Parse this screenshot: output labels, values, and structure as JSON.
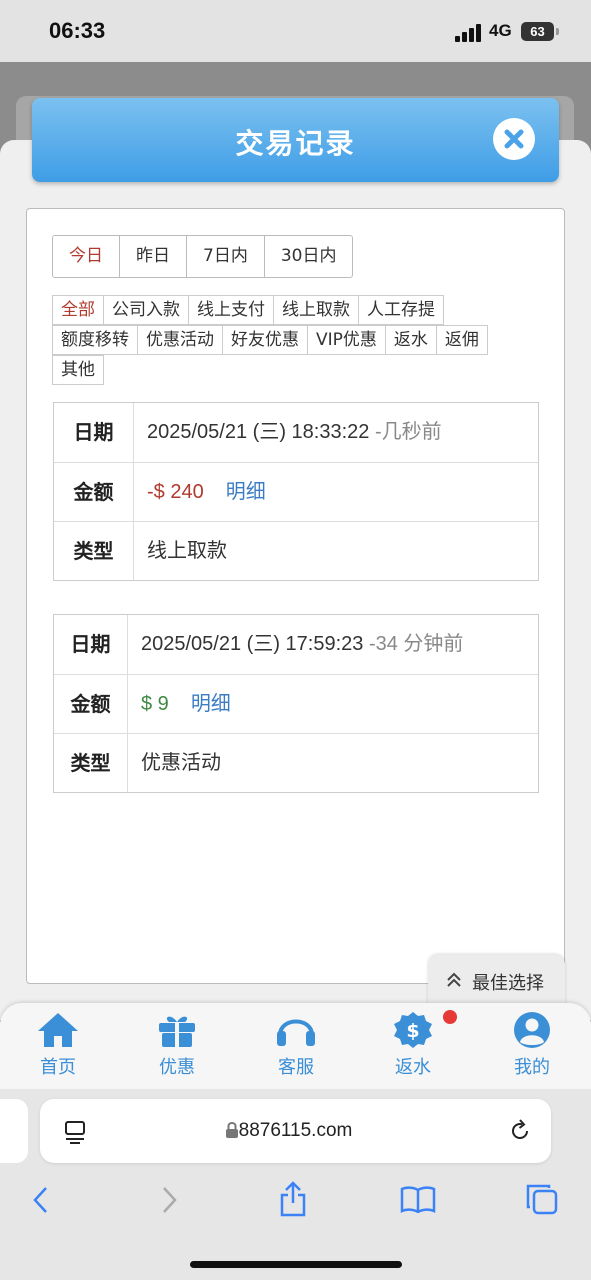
{
  "status_bar": {
    "time": "06:33",
    "network": "4G",
    "battery": "63"
  },
  "modal": {
    "title": "交易记录"
  },
  "date_tabs": [
    {
      "label": "今日",
      "active": true
    },
    {
      "label": "昨日",
      "active": false
    },
    {
      "label": "7日内",
      "active": false
    },
    {
      "label": "30日内",
      "active": false
    }
  ],
  "type_filters": [
    [
      "全部",
      "公司入款",
      "线上支付",
      "线上取款",
      "人工存提"
    ],
    [
      "额度移转",
      "优惠活动",
      "好友优惠",
      "VIP优惠",
      "返水",
      "返佣"
    ],
    [
      "其他"
    ]
  ],
  "active_type": "全部",
  "records": [
    {
      "date_label": "日期",
      "date": "2025/05/21 (三) 18:33:22",
      "ago": "-几秒前",
      "amount_label": "金额",
      "amount": "-$ 240",
      "amount_sign": "negative",
      "detail": "明细",
      "type_label": "类型",
      "type": "线上取款"
    },
    {
      "date_label": "日期",
      "date": "2025/05/21 (三) 17:59:23",
      "ago": "-34 分钟前",
      "amount_label": "金额",
      "amount": "$ 9",
      "amount_sign": "positive",
      "detail": "明细",
      "type_label": "类型",
      "type": "优惠活动"
    }
  ],
  "best_choice": {
    "label": "最佳选择"
  },
  "bottom_nav": [
    {
      "label": "首页",
      "icon": "home-icon"
    },
    {
      "label": "优惠",
      "icon": "gift-icon"
    },
    {
      "label": "客服",
      "icon": "headset-icon"
    },
    {
      "label": "返水",
      "icon": "dollar-badge-icon",
      "badge": true
    },
    {
      "label": "我的",
      "icon": "user-icon"
    }
  ],
  "browser": {
    "url": "8876115.com"
  },
  "colors": {
    "accent": "#3b8fd6",
    "negative": "#b03a2e",
    "positive": "#3f8a45",
    "header_top": "#7bc1f0",
    "header_bottom": "#3f9de6"
  }
}
